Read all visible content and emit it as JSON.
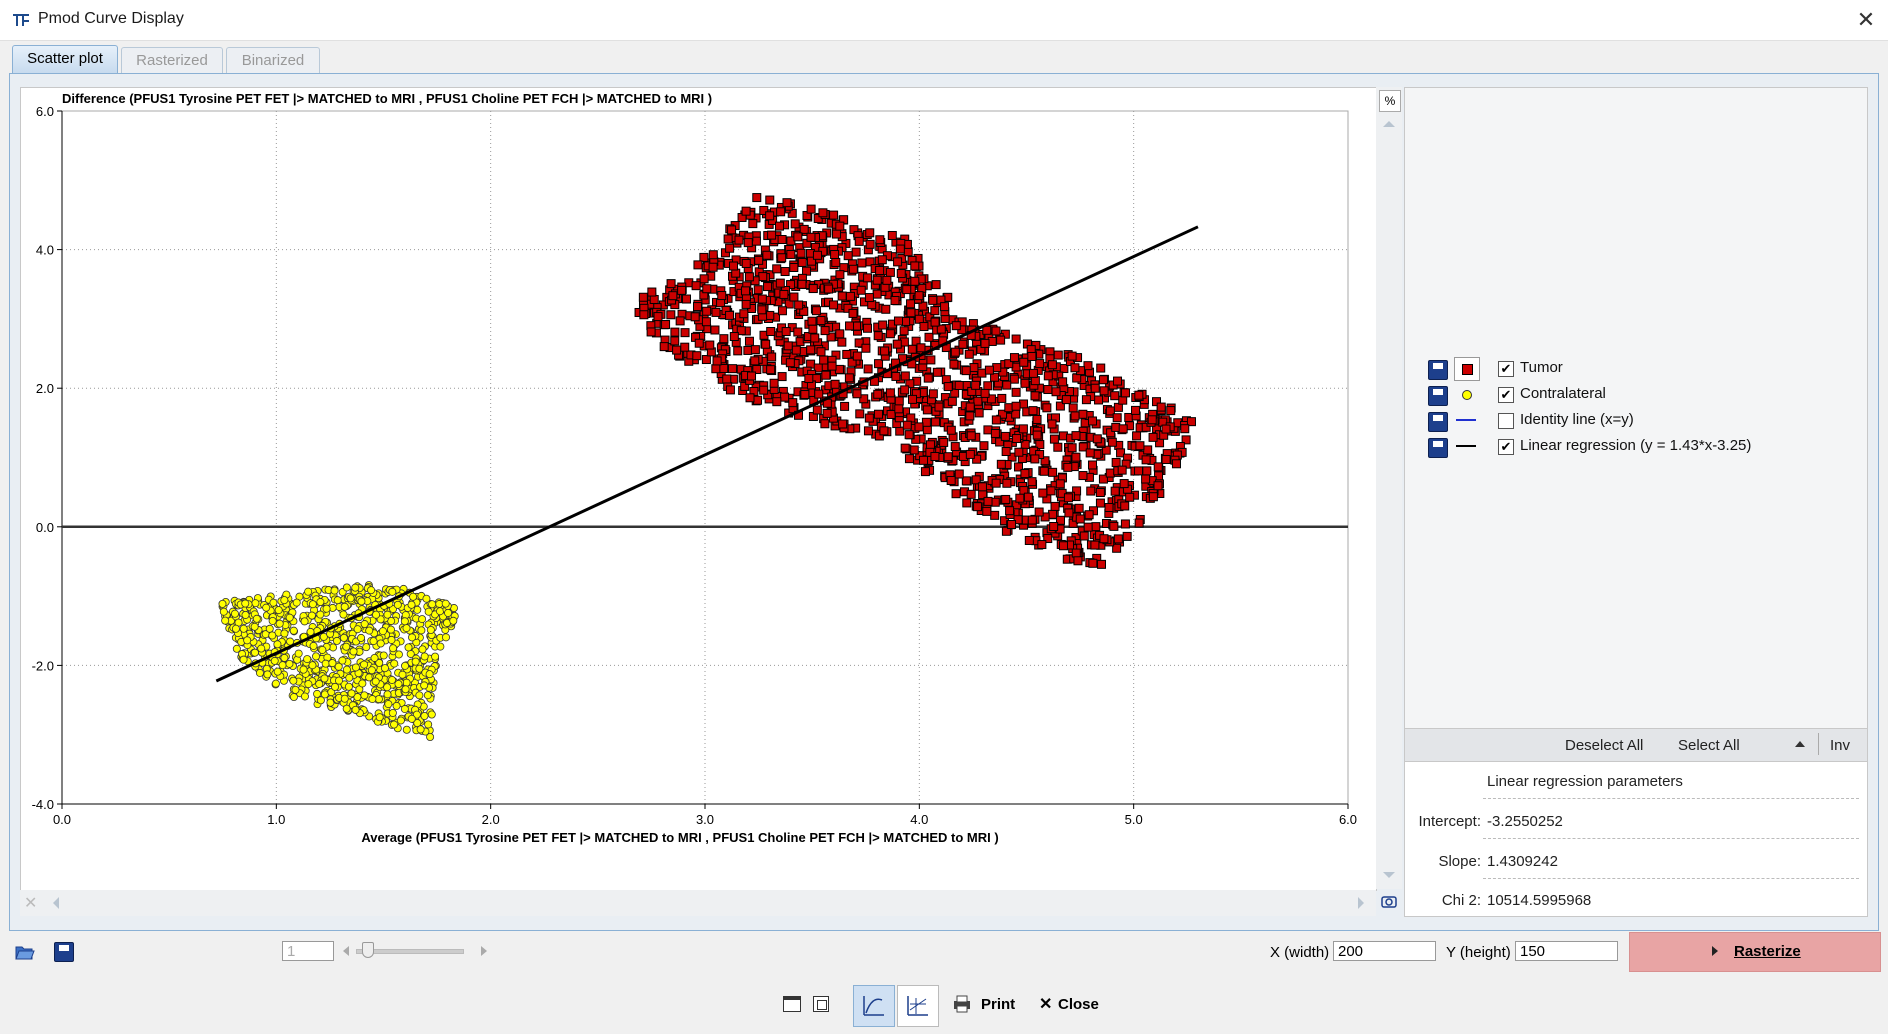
{
  "window": {
    "title": "Pmod Curve Display",
    "close_label": "✕"
  },
  "tabs": [
    {
      "label": "Scatter plot",
      "active": true
    },
    {
      "label": "Rasterized",
      "active": false
    },
    {
      "label": "Binarized",
      "active": false
    }
  ],
  "chart_data": {
    "type": "scatter",
    "title": "Difference (PFUS1 Tyrosine PET FET |> MATCHED to MRI , PFUS1 Choline PET FCH |> MATCHED to MRI )",
    "xlabel": "Average (PFUS1 Tyrosine PET FET |> MATCHED to MRI , PFUS1 Choline PET FCH |> MATCHED to MRI )",
    "ylabel": "",
    "xlim": [
      0.0,
      6.0
    ],
    "ylim": [
      -4.0,
      6.0
    ],
    "xticks": [
      "0.0",
      "1.0",
      "2.0",
      "3.0",
      "4.0",
      "5.0",
      "6.0"
    ],
    "yticks": [
      "6.0",
      "4.0",
      "2.0",
      "0.0",
      "-2.0",
      "-4.0"
    ],
    "grid": true,
    "series": [
      {
        "name": "Tumor",
        "marker": "square",
        "color": "#cc0000",
        "cluster_polygon": [
          [
            2.65,
            3.2
          ],
          [
            3.0,
            3.9
          ],
          [
            3.25,
            4.8
          ],
          [
            3.5,
            4.6
          ],
          [
            3.95,
            4.2
          ],
          [
            4.2,
            3.0
          ],
          [
            4.8,
            2.4
          ],
          [
            5.3,
            1.5
          ],
          [
            5.1,
            0.3
          ],
          [
            4.85,
            -0.6
          ],
          [
            4.55,
            -0.4
          ],
          [
            4.1,
            0.6
          ],
          [
            3.8,
            1.3
          ],
          [
            3.4,
            1.6
          ],
          [
            3.1,
            2.0
          ],
          [
            2.8,
            2.6
          ]
        ],
        "count": 1500
      },
      {
        "name": "Contralateral",
        "marker": "circle",
        "color": "#ffff00",
        "cluster_polygon": [
          [
            0.72,
            -1.1
          ],
          [
            1.5,
            -0.8
          ],
          [
            1.85,
            -1.15
          ],
          [
            1.75,
            -2.0
          ],
          [
            1.72,
            -3.05
          ],
          [
            1.45,
            -2.8
          ],
          [
            1.1,
            -2.5
          ],
          [
            0.85,
            -2.0
          ]
        ],
        "count": 900
      },
      {
        "name": "Linear regression (y = 1.43*x-3.25)",
        "type": "line",
        "color": "#000000",
        "intercept": -3.2550252,
        "slope": 1.4309242,
        "x_range": [
          0.72,
          5.3
        ]
      },
      {
        "name": "Zero line",
        "type": "hline",
        "color": "#333333",
        "y": 0.0
      }
    ]
  },
  "legend": [
    {
      "label": "Tumor",
      "checked": true,
      "symbol": "red-square"
    },
    {
      "label": "Contralateral",
      "checked": true,
      "symbol": "yellow-circle"
    },
    {
      "label": "Identity line (x=y)",
      "checked": false,
      "symbol": "blue-line"
    },
    {
      "label": "Linear regression (y = 1.43*x-3.25)",
      "checked": true,
      "symbol": "black-line"
    }
  ],
  "legend_buttons": {
    "deselect_all": "Deselect All",
    "select_all": "Select All",
    "inv": "Inv"
  },
  "regression": {
    "header": "Linear regression parameters",
    "intercept_label": "Intercept:",
    "intercept_value": "-3.2550252",
    "slope_label": "Slope:",
    "slope_value": "1.4309242",
    "chi2_label": "Chi 2:",
    "chi2_value": "10514.5995968"
  },
  "scroll": {
    "corner_label": "%"
  },
  "slider_field": {
    "value": "1"
  },
  "size": {
    "x_label": "X (width)",
    "x_value": "200",
    "y_label": "Y (height)",
    "y_value": "150"
  },
  "rasterize_label": "Rasterize",
  "bottom": {
    "print_label": "Print",
    "close_label": "Close"
  }
}
